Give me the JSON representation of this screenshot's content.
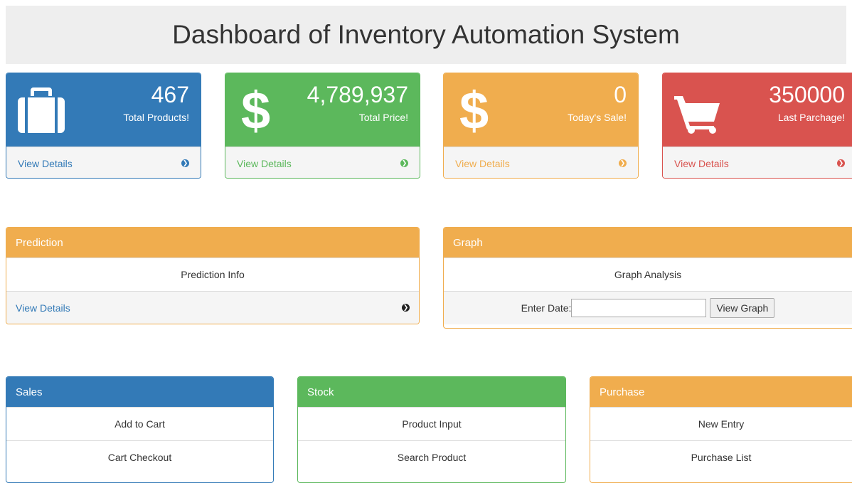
{
  "header": {
    "title": "Dashboard of Inventory Automation System"
  },
  "stats": [
    {
      "value": "467",
      "label": "Total Products!",
      "link": "View Details",
      "icon": "briefcase-icon",
      "color": "#337ab7"
    },
    {
      "value": "4,789,937",
      "label": "Total Price!",
      "link": "View Details",
      "icon": "dollar-icon",
      "color": "#5cb85c"
    },
    {
      "value": "0",
      "label": "Today's Sale!",
      "link": "View Details",
      "icon": "dollar-icon",
      "color": "#f0ad4e"
    },
    {
      "value": "350000",
      "label": "Last Parchage!",
      "link": "View Details",
      "icon": "shopping-cart-icon",
      "color": "#d9534f"
    }
  ],
  "prediction": {
    "title": "Prediction",
    "info": "Prediction Info",
    "link": "View Details"
  },
  "graph": {
    "title": "Graph",
    "info": "Graph Analysis",
    "date_label": "Enter Date:",
    "date_value": "",
    "button": "View Graph"
  },
  "sales": {
    "title": "Sales",
    "items": [
      "Add to Cart",
      "Cart Checkout"
    ]
  },
  "stock": {
    "title": "Stock",
    "items": [
      "Product Input",
      "Search Product"
    ]
  },
  "purchase": {
    "title": "Purchase",
    "items": [
      "New Entry",
      "Purchase List"
    ]
  }
}
